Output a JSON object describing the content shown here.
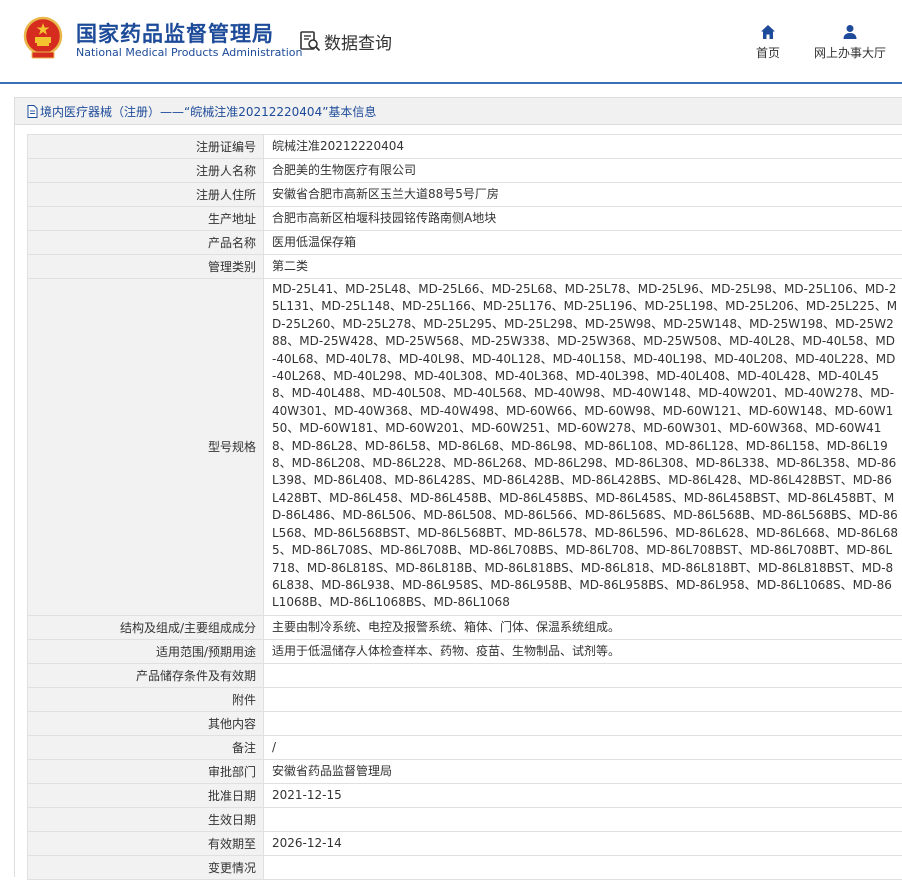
{
  "header": {
    "title": "国家药品监督管理局",
    "subtitle": "National Medical Products Administration",
    "query_label": "数据查询",
    "nav": [
      {
        "label": "首页",
        "icon": "home-icon"
      },
      {
        "label": "网上办事大厅",
        "icon": "user-icon"
      }
    ]
  },
  "breadcrumb": "境内医疗器械（注册）——“皖械注准20212220404”基本信息",
  "rows": [
    {
      "label": "注册证编号",
      "value": "皖械注准20212220404"
    },
    {
      "label": "注册人名称",
      "value": "合肥美的生物医疗有限公司"
    },
    {
      "label": "注册人住所",
      "value": "安徽省合肥市高新区玉兰大道88号5号厂房"
    },
    {
      "label": "生产地址",
      "value": "合肥市高新区柏堰科技园铭传路南侧A地块"
    },
    {
      "label": "产品名称",
      "value": "医用低温保存箱"
    },
    {
      "label": "管理类别",
      "value": "第二类"
    },
    {
      "label": "型号规格",
      "value": "MD-25L41、MD-25L48、MD-25L66、MD-25L68、MD-25L78、MD-25L96、MD-25L98、MD-25L106、MD-25L131、MD-25L148、MD-25L166、MD-25L176、MD-25L196、MD-25L198、MD-25L206、MD-25L225、MD-25L260、MD-25L278、MD-25L295、MD-25L298、MD-25W98、MD-25W148、MD-25W198、MD-25W288、MD-25W428、MD-25W568、MD-25W338、MD-25W368、MD-25W508、MD-40L28、MD-40L58、MD-40L68、MD-40L78、MD-40L98、MD-40L128、MD-40L158、MD-40L198、MD-40L208、MD-40L228、MD-40L268、MD-40L298、MD-40L308、MD-40L368、MD-40L398、MD-40L408、MD-40L428、MD-40L458、MD-40L488、MD-40L508、MD-40L568、MD-40W98、MD-40W148、MD-40W201、MD-40W278、MD-40W301、MD-40W368、MD-40W498、MD-60W66、MD-60W98、MD-60W121、MD-60W148、MD-60W150、MD-60W181、MD-60W201、MD-60W251、MD-60W278、MD-60W301、MD-60W368、MD-60W418、MD-86L28、MD-86L58、MD-86L68、MD-86L98、MD-86L108、MD-86L128、MD-86L158、MD-86L198、MD-86L208、MD-86L228、MD-86L268、MD-86L298、MD-86L308、MD-86L338、MD-86L358、MD-86L398、MD-86L408、MD-86L428S、MD-86L428B、MD-86L428BS、MD-86L428、MD-86L428BST、MD-86L428BT、MD-86L458、MD-86L458B、MD-86L458BS、MD-86L458S、MD-86L458BST、MD-86L458BT、MD-86L486、MD-86L506、MD-86L508、MD-86L566、MD-86L568S、MD-86L568B、MD-86L568BS、MD-86L568、MD-86L568BST、MD-86L568BT、MD-86L578、MD-86L596、MD-86L628、MD-86L668、MD-86L685、MD-86L708S、MD-86L708B、MD-86L708BS、MD-86L708、MD-86L708BST、MD-86L708BT、MD-86L718、MD-86L818S、MD-86L818B、MD-86L818BS、MD-86L818、MD-86L818BT、MD-86L818BST、MD-86L838、MD-86L938、MD-86L958S、MD-86L958B、MD-86L958BS、MD-86L958、MD-86L1068S、MD-86L1068B、MD-86L1068BS、MD-86L1068"
    },
    {
      "label": "结构及组成/主要组成成分",
      "value": "主要由制冷系统、电控及报警系统、箱体、门体、保温系统组成。"
    },
    {
      "label": "适用范围/预期用途",
      "value": "适用于低温储存人体检查样本、药物、疫苗、生物制品、试剂等。"
    },
    {
      "label": "产品储存条件及有效期",
      "value": ""
    },
    {
      "label": "附件",
      "value": ""
    },
    {
      "label": "其他内容",
      "value": ""
    },
    {
      "label": "备注",
      "value": "/"
    },
    {
      "label": "审批部门",
      "value": "安徽省药品监督管理局"
    },
    {
      "label": "批准日期",
      "value": "2021-12-15"
    },
    {
      "label": "生效日期",
      "value": ""
    },
    {
      "label": "有效期至",
      "value": "2026-12-14"
    },
    {
      "label": "变更情况",
      "value": ""
    }
  ]
}
